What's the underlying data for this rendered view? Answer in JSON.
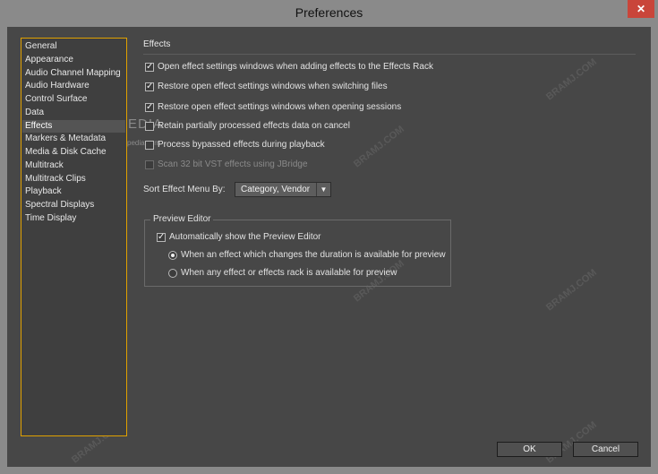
{
  "window": {
    "title": "Preferences"
  },
  "sidebar": {
    "items": [
      "General",
      "Appearance",
      "Audio Channel Mapping",
      "Audio Hardware",
      "Control Surface",
      "Data",
      "Effects",
      "Markers & Metadata",
      "Media & Disk Cache",
      "Multitrack",
      "Multitrack Clips",
      "Playback",
      "Spectral Displays",
      "Time Display"
    ],
    "selected": "Effects"
  },
  "effects": {
    "section_label": "Effects",
    "options": [
      {
        "label": "Open effect settings windows when adding effects to the Effects Rack",
        "checked": true,
        "disabled": false
      },
      {
        "label": "Restore open effect settings windows when switching files",
        "checked": true,
        "disabled": false
      },
      {
        "label": "Restore open effect settings windows when opening sessions",
        "checked": true,
        "disabled": false
      },
      {
        "label": "Retain partially processed effects data on cancel",
        "checked": false,
        "disabled": false
      },
      {
        "label": "Process bypassed effects during playback",
        "checked": false,
        "disabled": false
      },
      {
        "label": "Scan 32 bit VST effects using JBridge",
        "checked": false,
        "disabled": true
      }
    ],
    "sort_label": "Sort Effect Menu By:",
    "sort_value": "Category, Vendor"
  },
  "preview_editor": {
    "title": "Preview Editor",
    "auto_show_label": "Automatically show the Preview Editor",
    "auto_show_checked": true,
    "options": [
      {
        "label": "When an effect which changes the duration is available for preview",
        "selected": true
      },
      {
        "label": "When any effect or effects rack is available for preview",
        "selected": false
      }
    ]
  },
  "buttons": {
    "ok": "OK",
    "cancel": "Cancel"
  },
  "watermark": {
    "softpedia": "SOFTPEDIA",
    "softpedia_url": "www.softpedia.com",
    "bramj": "BRAMJ.COM"
  },
  "icons": {
    "close": "close-icon",
    "dropdown": "chevron-down-icon"
  }
}
